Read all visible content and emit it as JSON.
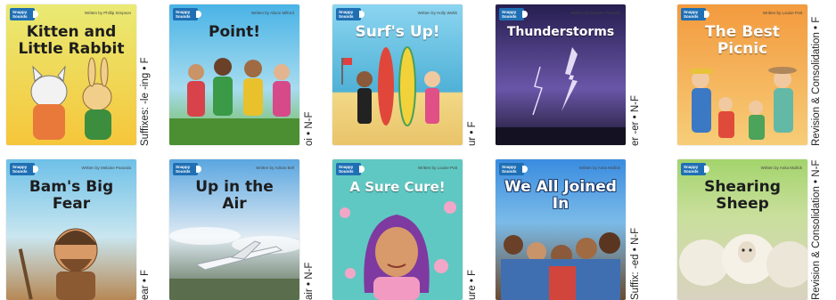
{
  "logo_text": "Snappy\nSounds",
  "books": [
    {
      "title": "Kitten and Little Rabbit",
      "author": "Written by Phillip Simpson",
      "label": "Suffixes: -le -ing  •  F",
      "bg1": "#e6e86a",
      "bg2": "#f4c22e",
      "title_style": "dark"
    },
    {
      "title": "Point!",
      "author": "Written by Alison Milford",
      "label": "oi  •  N-F",
      "bg1": "#4bb6e8",
      "bg2": "#8fd16b",
      "title_style": "dark"
    },
    {
      "title": "Surf's Up!",
      "author": "Written by Holly Webb",
      "label": "ur  •  F",
      "bg1": "#8ad3ef",
      "bg2": "#f2d27b",
      "title_style": "white"
    },
    {
      "title": "Thunderstorms",
      "author": "Written by Melaine Paranda",
      "label": "er -er  •  N-F",
      "bg1": "#3a2f6b",
      "bg2": "#6f5aa8",
      "title_style": "white"
    },
    {
      "title": "The Best Picnic",
      "author": "Written by Louise Pott",
      "label": "Revision & Consolidation  •  F",
      "bg1": "#f6a84a",
      "bg2": "#f7d183",
      "title_style": "white"
    },
    {
      "title": "Bam's Big Fear",
      "author": "Written by Melaine Paranda",
      "label": "ear  •  F",
      "bg1": "#6fbfe6",
      "bg2": "#c89a5e",
      "title_style": "dark"
    },
    {
      "title": "Up in the Air",
      "author": "Written by Adrian Bell",
      "label": "air  •  N-F",
      "bg1": "#6fb2e4",
      "bg2": "#4f6f8a",
      "title_style": "dark"
    },
    {
      "title": "A Sure Cure!",
      "author": "Written by Louise Pott",
      "label": "ure  •  F",
      "bg1": "#5fc9c4",
      "bg2": "#f07ab4",
      "title_style": "white"
    },
    {
      "title": "We All Joined In",
      "author": "Written by Anita Mullick",
      "label": "Suffix: -ed  •  N-F",
      "bg1": "#3d8de0",
      "bg2": "#7a5b3a",
      "title_style": "stroke"
    },
    {
      "title": "Shearing Sheep",
      "author": "Written by Anita Mullick",
      "label": "Revision & Consolidation  •  N-F",
      "bg1": "#a6d66a",
      "bg2": "#e9e3d4",
      "title_style": "dark"
    }
  ]
}
